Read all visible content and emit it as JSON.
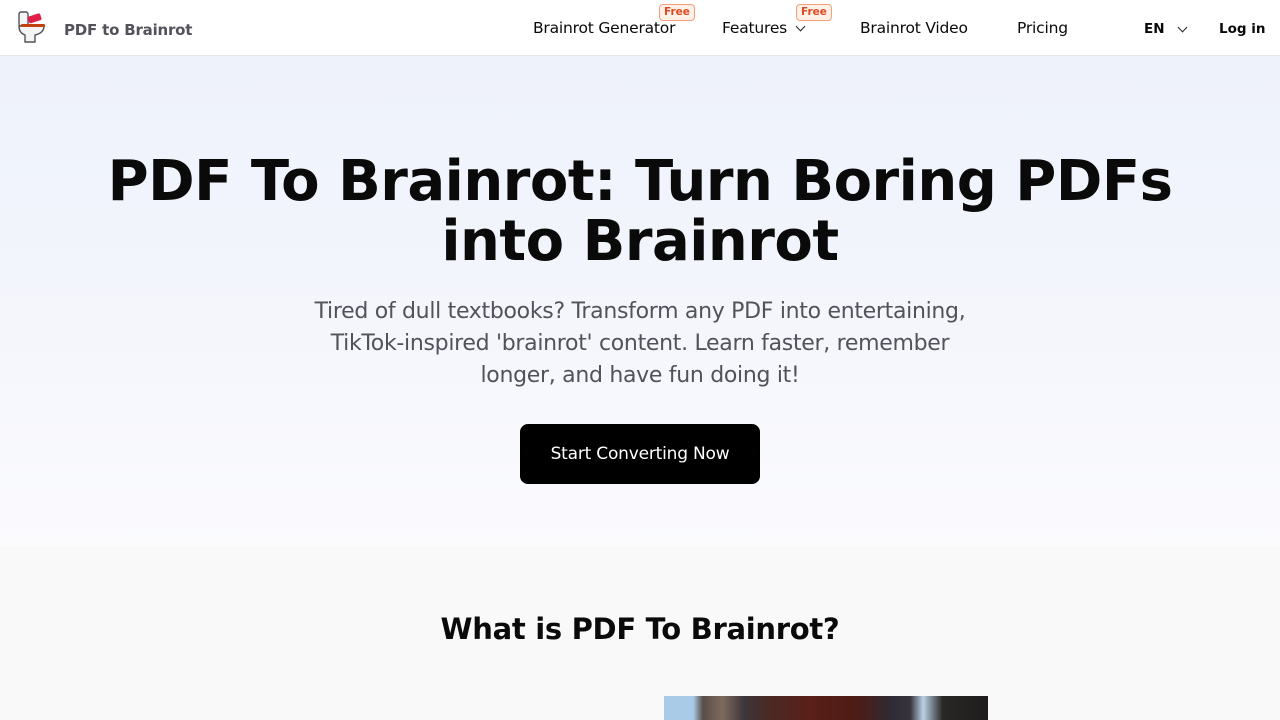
{
  "nav": {
    "brand": "PDF to Brainrot",
    "links": [
      {
        "label": "Brainrot Generator",
        "badge": "Free"
      },
      {
        "label": "Features",
        "badge": "Free",
        "has_dropdown": true
      },
      {
        "label": "Brainrot Video"
      },
      {
        "label": "Pricing"
      }
    ],
    "language": "EN",
    "login_label": "Log in"
  },
  "hero": {
    "title": "PDF To Brainrot: Turn Boring PDFs into Brainrot",
    "subtitle": "Tired of dull textbooks? Transform any PDF into entertaining, TikTok-inspired 'brainrot' content. Learn faster, remember longer, and have fun doing it!",
    "cta_label": "Start Converting Now"
  },
  "what_section": {
    "heading": "What is PDF To Brainrot?",
    "media": "video-thumbnail"
  },
  "colors": {
    "badge_text": "#dc4a24",
    "badge_bg": "#fff1e8",
    "cta_bg": "#000000",
    "hero_bg": "#eef2fb"
  }
}
